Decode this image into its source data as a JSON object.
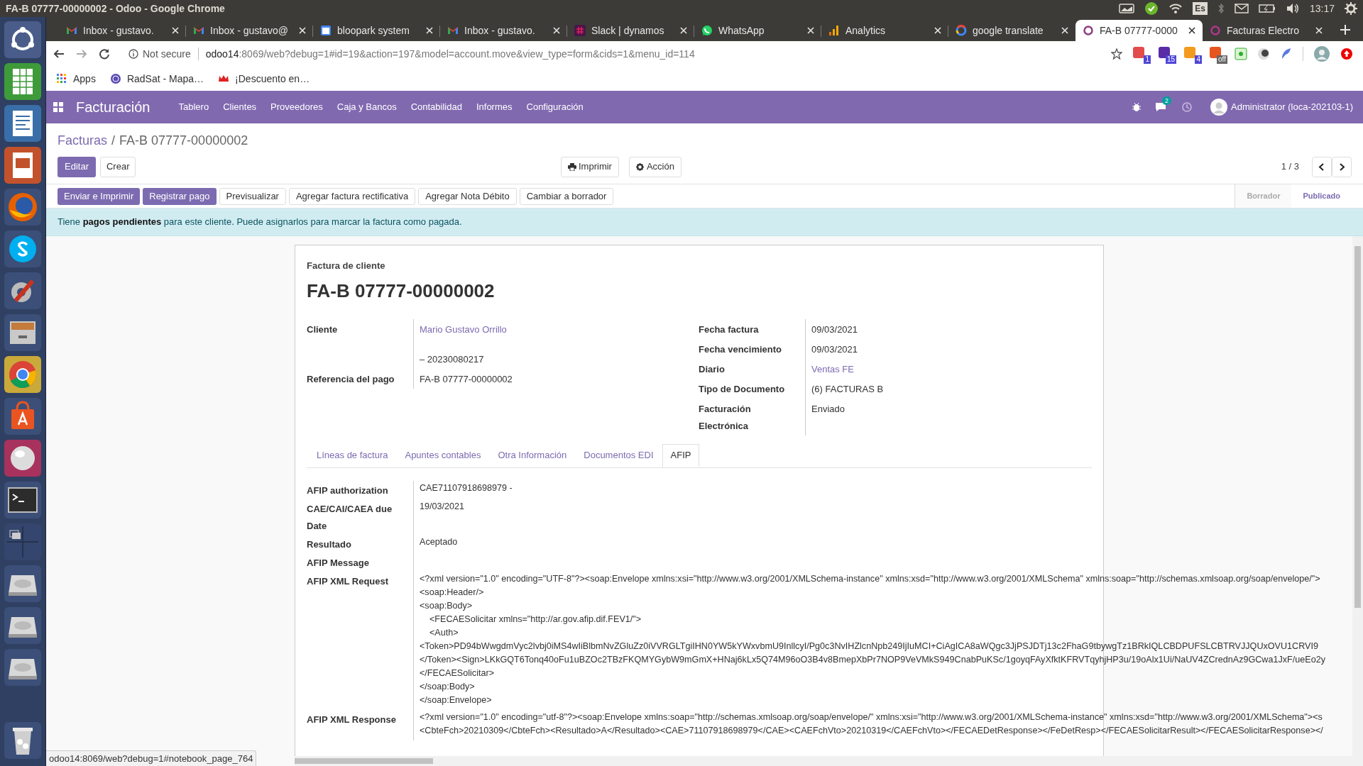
{
  "window": {
    "title": "FA-B 07777-00000002 - Odoo - Google Chrome"
  },
  "system_tray": {
    "keyboard": "Es",
    "clock": "13:17"
  },
  "browser_tabs": [
    {
      "title": "Inbox - gustavo.",
      "selected": false
    },
    {
      "title": "Inbox - gustavo@",
      "selected": false
    },
    {
      "title": "bloopark system",
      "selected": false
    },
    {
      "title": "Inbox - gustavo.",
      "selected": false
    },
    {
      "title": "Slack | dynamos",
      "selected": false
    },
    {
      "title": "WhatsApp",
      "selected": false
    },
    {
      "title": "Analytics",
      "selected": false
    },
    {
      "title": "google translate",
      "selected": false
    },
    {
      "title": "FA-B 07777-0000",
      "selected": true
    },
    {
      "title": "Facturas Electro",
      "selected": false
    }
  ],
  "address_bar": {
    "security": "Not secure",
    "host": "odoo14",
    "path": ":8069/web?debug=1#id=19&action=197&model=account.move&view_type=form&cids=1&menu_id=114"
  },
  "extension_badges": [
    "1",
    "15",
    "4",
    "off"
  ],
  "bookmarks": [
    {
      "label": "Apps"
    },
    {
      "label": "RadSat - Mapa…"
    },
    {
      "label": "¡Descuento en…"
    }
  ],
  "odoo_nav": {
    "app": "Facturación",
    "menu": [
      "Tablero",
      "Clientes",
      "Proveedores",
      "Caja y Bancos",
      "Contabilidad",
      "Informes",
      "Configuración"
    ],
    "messages_badge": "2",
    "user": "Administrator (loca-202103-1)"
  },
  "breadcrumb": {
    "parent": "Facturas",
    "separator": "/",
    "current": "FA-B 07777-00000002"
  },
  "control_buttons": {
    "primary": "Editar",
    "secondary": "Crear",
    "print": "Imprimir",
    "action": "Acción",
    "pager": "1 / 3"
  },
  "header_buttons": [
    {
      "label": "Enviar e Imprimir",
      "primary": true
    },
    {
      "label": "Registrar pago",
      "primary": true
    },
    {
      "label": "Previsualizar",
      "primary": false
    },
    {
      "label": "Agregar factura rectificativa",
      "primary": false
    },
    {
      "label": "Agregar Nota Débito",
      "primary": false
    },
    {
      "label": "Cambiar a borrador",
      "primary": false
    }
  ],
  "status_stages": [
    {
      "label": "Borrador",
      "selected": false
    },
    {
      "label": "Publicado",
      "selected": true
    }
  ],
  "alert": "Tiene **pagos pendientes** para este cliente. Puede asignarlos para marcar la factura como pagada.",
  "form": {
    "subtitle": "Factura de cliente",
    "name": "FA-B 07777-00000002",
    "left_fields": [
      {
        "label": "Cliente",
        "value": "Mario Gustavo Orrillo",
        "link": true
      },
      {
        "value": "– 20230080217",
        "link": false
      },
      {
        "label": "Referencia del pago",
        "value": "FA-B 07777-00000002",
        "link": false
      }
    ],
    "right_fields": [
      {
        "label": "Fecha factura",
        "value": "09/03/2021",
        "link": false
      },
      {
        "label": "Fecha vencimiento",
        "value": "09/03/2021",
        "link": false
      },
      {
        "label": "Diario",
        "value": "Ventas FE",
        "link": true
      },
      {
        "label": "Tipo de Documento",
        "value": "(6) FACTURAS B",
        "link": false
      },
      {
        "label": "Facturación Electrónica",
        "value": "Enviado",
        "link": false
      }
    ]
  },
  "notebook_tabs": [
    {
      "label": "Líneas de factura",
      "selected": false
    },
    {
      "label": "Apuntes contables",
      "selected": false
    },
    {
      "label": "Otra Información",
      "selected": false
    },
    {
      "label": "Documentos EDI",
      "selected": false
    },
    {
      "label": "AFIP",
      "selected": true
    }
  ],
  "afip_fields": [
    {
      "label": "AFIP authorization",
      "lines": [
        {
          "text": "CAE71107918698979 -",
          "indented": false
        }
      ]
    },
    {
      "label": "CAE/CAI/CAEA due Date",
      "lines": [
        {
          "text": "19/03/2021",
          "indented": false
        }
      ]
    },
    {
      "label": "Resultado",
      "lines": [
        {
          "text": "Aceptado",
          "indented": false
        }
      ]
    },
    {
      "label": "AFIP Message"
    },
    {
      "label": "AFIP XML Request",
      "lines": [
        {
          "text": "<?xml version=\"1.0\" encoding=\"UTF-8\"?><soap:Envelope xmlns:xsi=\"http://www.w3.org/2001/XMLSchema-instance\" xmlns:xsd=\"http://www.w3.org/2001/XMLSchema\" xmlns:soap=\"http://schemas.xmlsoap.org/soap/envelope/\">",
          "indented": false
        },
        {
          "text": "<soap:Header/>",
          "indented": false
        },
        {
          "text": "<soap:Body>",
          "indented": false
        },
        {
          "text": "<FECAESolicitar xmlns=\"http://ar.gov.afip.dif.FEV1/\">",
          "indented": true
        },
        {
          "text": "<Auth>",
          "indented": true
        },
        {
          "text": "<Token>PD94bWwgdmVyc2lvbj0iMS4wIiBlbmNvZGluZz0iVVRGLTgiIHN0YW5kYWxvbmU9InllcyI/Pg0c3NvIHZlcnNpb249IjIuMCI+CiAgICA8aWQgc3JjPSJDTj13c2FhaG9tbywgTz1BRkIQLCBDPUFSLCBTRVJJQUxOVU1CRVI9",
          "indented": false
        },
        {
          "text": "</Token><Sign>LKkGQT6Tonq40oFu1uBZOc2TBzFKQMYGybW9mGmX+HNaj6kLx5Q74M96oO3B4v8BmepXbPr7NOP9VeVMkS949CnabPuKSc/1goyqFAyXfktKFRVTqyhjHP3u/19oAlx1Ui/NaUV4ZCrednAz9GCwa1JxF/ueEo2y",
          "indented": false
        },
        {
          "text": "</FECAESolicitar>",
          "indented": false
        },
        {
          "text": "</soap:Body>",
          "indented": false
        },
        {
          "text": "</soap:Envelope>",
          "indented": false
        }
      ]
    },
    {
      "label": "AFIP XML Response",
      "lines": [
        {
          "text": "<?xml version=\"1.0\" encoding=\"utf-8\"?><soap:Envelope xmlns:soap=\"http://schemas.xmlsoap.org/soap/envelope/\" xmlns:xsi=\"http://www.w3.org/2001/XMLSchema-instance\" xmlns:xsd=\"http://www.w3.org/2001/XMLSchema\"><s",
          "indented": false
        },
        {
          "text": "<CbteFch>20210309</CbteFch><Resultado>A</Resultado><CAE>71107918698979</CAE><CAEFchVto>20210319</CAEFchVto></FECAEDetResponse></FeDetResp></FECAESolicitarResult></FECAESolicitarResponse></",
          "indented": false
        }
      ]
    }
  ],
  "status_link": "odoo14:8069/web?debug=1#notebook_page_764"
}
